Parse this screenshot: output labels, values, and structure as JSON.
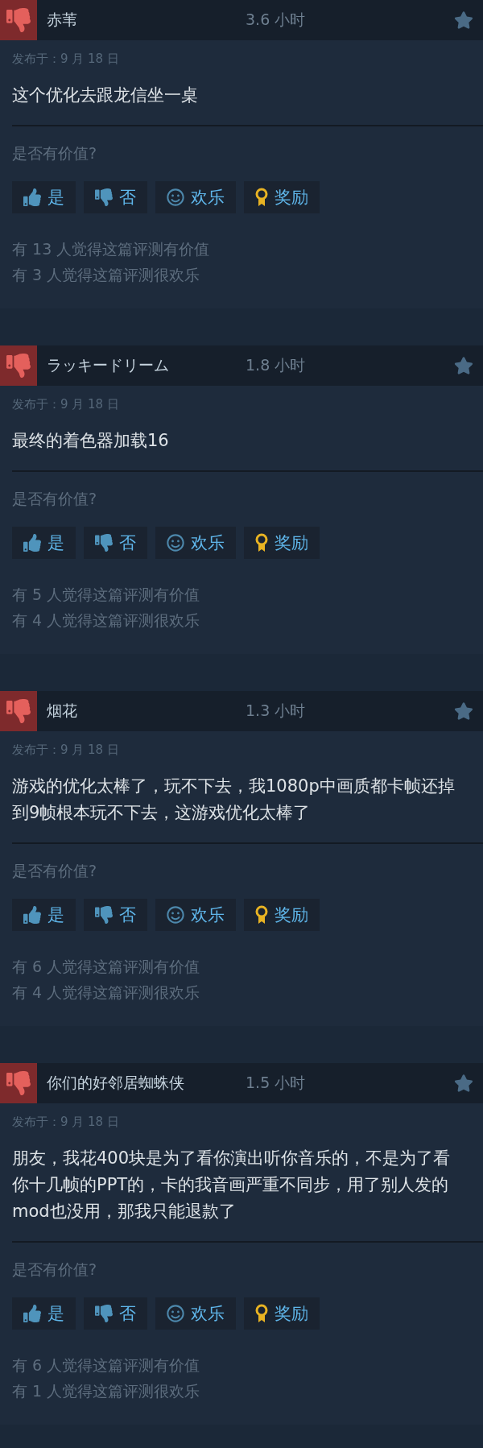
{
  "reviews": [
    {
      "recommended": false,
      "username": "赤苇",
      "hours": "3.6 小时",
      "posted": "发布于：9 月 18 日",
      "text": "这个优化去跟龙信坐一桌",
      "prompt": "是否有价值?",
      "buttons": [
        {
          "kind": "yes",
          "label": "是"
        },
        {
          "kind": "no",
          "label": "否"
        },
        {
          "kind": "funny",
          "label": "欢乐"
        },
        {
          "kind": "award",
          "label": "奖励"
        }
      ],
      "counts": [
        "有 13 人觉得这篇评测有价值",
        "有 3 人觉得这篇评测很欢乐"
      ]
    },
    {
      "recommended": false,
      "username": "ラッキードリーム",
      "hours": "1.8 小时",
      "posted": "发布于：9 月 18 日",
      "text": "最终的着色器加载16",
      "prompt": "是否有价值?",
      "buttons": [
        {
          "kind": "yes",
          "label": "是"
        },
        {
          "kind": "no",
          "label": "否"
        },
        {
          "kind": "funny",
          "label": "欢乐"
        },
        {
          "kind": "award",
          "label": "奖励"
        }
      ],
      "counts": [
        "有 5 人觉得这篇评测有价值",
        "有 4 人觉得这篇评测很欢乐"
      ]
    },
    {
      "recommended": false,
      "username": "烟花",
      "hours": "1.3 小时",
      "posted": "发布于：9 月 18 日",
      "text": "游戏的优化太棒了，玩不下去，我1080p中画质都卡帧还掉到9帧根本玩不下去，这游戏优化太棒了",
      "prompt": "是否有价值?",
      "buttons": [
        {
          "kind": "yes",
          "label": "是"
        },
        {
          "kind": "no",
          "label": "否"
        },
        {
          "kind": "funny",
          "label": "欢乐"
        },
        {
          "kind": "award",
          "label": "奖励"
        }
      ],
      "counts": [
        "有 6 人觉得这篇评测有价值",
        "有 4 人觉得这篇评测很欢乐"
      ]
    },
    {
      "recommended": false,
      "username": "你们的好邻居蜘蛛侠",
      "hours": "1.5 小时",
      "posted": "发布于：9 月 18 日",
      "text": "朋友，我花400块是为了看你演出听你音乐的，不是为了看你十几帧的PPT的，卡的我音画严重不同步，用了别人发的mod也没用，那我只能退款了",
      "prompt": "是否有价值?",
      "buttons": [
        {
          "kind": "yes",
          "label": "是"
        },
        {
          "kind": "no",
          "label": "否"
        },
        {
          "kind": "funny",
          "label": "欢乐"
        },
        {
          "kind": "award",
          "label": "奖励"
        }
      ],
      "counts": [
        "有 6 人觉得这篇评测有价值",
        "有 1 人觉得这篇评测很欢乐"
      ]
    }
  ]
}
